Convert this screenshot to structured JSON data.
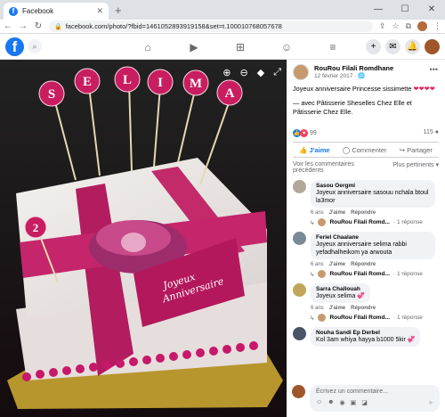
{
  "browser": {
    "tab_title": "Facebook",
    "new_tab_icon": "+",
    "url": "facebook.com/photo/?fbid=1461052893919158&set=t.100010768057678",
    "window_controls": [
      "—",
      "☐",
      "✕"
    ]
  },
  "photo": {
    "cake_letters": [
      "S",
      "E",
      "L",
      "I",
      "M",
      "A"
    ],
    "age_number": "2",
    "ribbon_text_line1": "Joyeux",
    "ribbon_text_line2": "Anniversaire"
  },
  "post": {
    "author": "RouRou Filali Romdhane",
    "date": "12 février 2017 · ",
    "text_line1": "Joyeux anniversaire Princesse sissimette ",
    "hearts": "❤❤❤❤",
    "text_line2": "— avec Pâtisserie Sheselles Chez Elle et Pâtisserie Chez Elle.",
    "reaction_count": "99",
    "comment_count": "115",
    "like_label": "J'aime",
    "comment_label": "Commenter",
    "share_label": "Partager"
  },
  "comments_header": {
    "left": "Voir les commentaires précédents",
    "right": "Plus pertinents ▾"
  },
  "comments": [
    {
      "name": "Sasou Oergmi",
      "text": "Joyeux anniversaire sasouu nchala btoul la3mor",
      "time": "6 ans",
      "like": "J'aime",
      "reply": "Répondre",
      "avatar_color": "#b3a79a",
      "replier": "RouRou Filali Romd...",
      "reply_count": "· 1 réponse"
    },
    {
      "name": "Feriel Chaalane",
      "text": "Joyeux anniversaire selima rabbi yefadhalheikom ya arwouta",
      "time": "6 ans",
      "like": "J'aime",
      "reply": "Répondre",
      "avatar_color": "#7a8a96",
      "replier": "RouRou Filali Romd...",
      "reply_count": "· 1 réponse"
    },
    {
      "name": "Sarra Challouah",
      "text": "Joyeux selima 💞",
      "time": "6 ans",
      "like": "J'aime",
      "reply": "Répondre",
      "avatar_color": "#c0a55a",
      "replier": "RouRou Filali Romd...",
      "reply_count": "· 1 réponse"
    },
    {
      "name": "Nouha Sandi Ep Derbel",
      "text": "Kol 3am whiya hayya b1000 5kir 💞",
      "avatar_color": "#4a5468"
    }
  ],
  "composer": {
    "placeholder": "Écrivez un commentaire..."
  }
}
